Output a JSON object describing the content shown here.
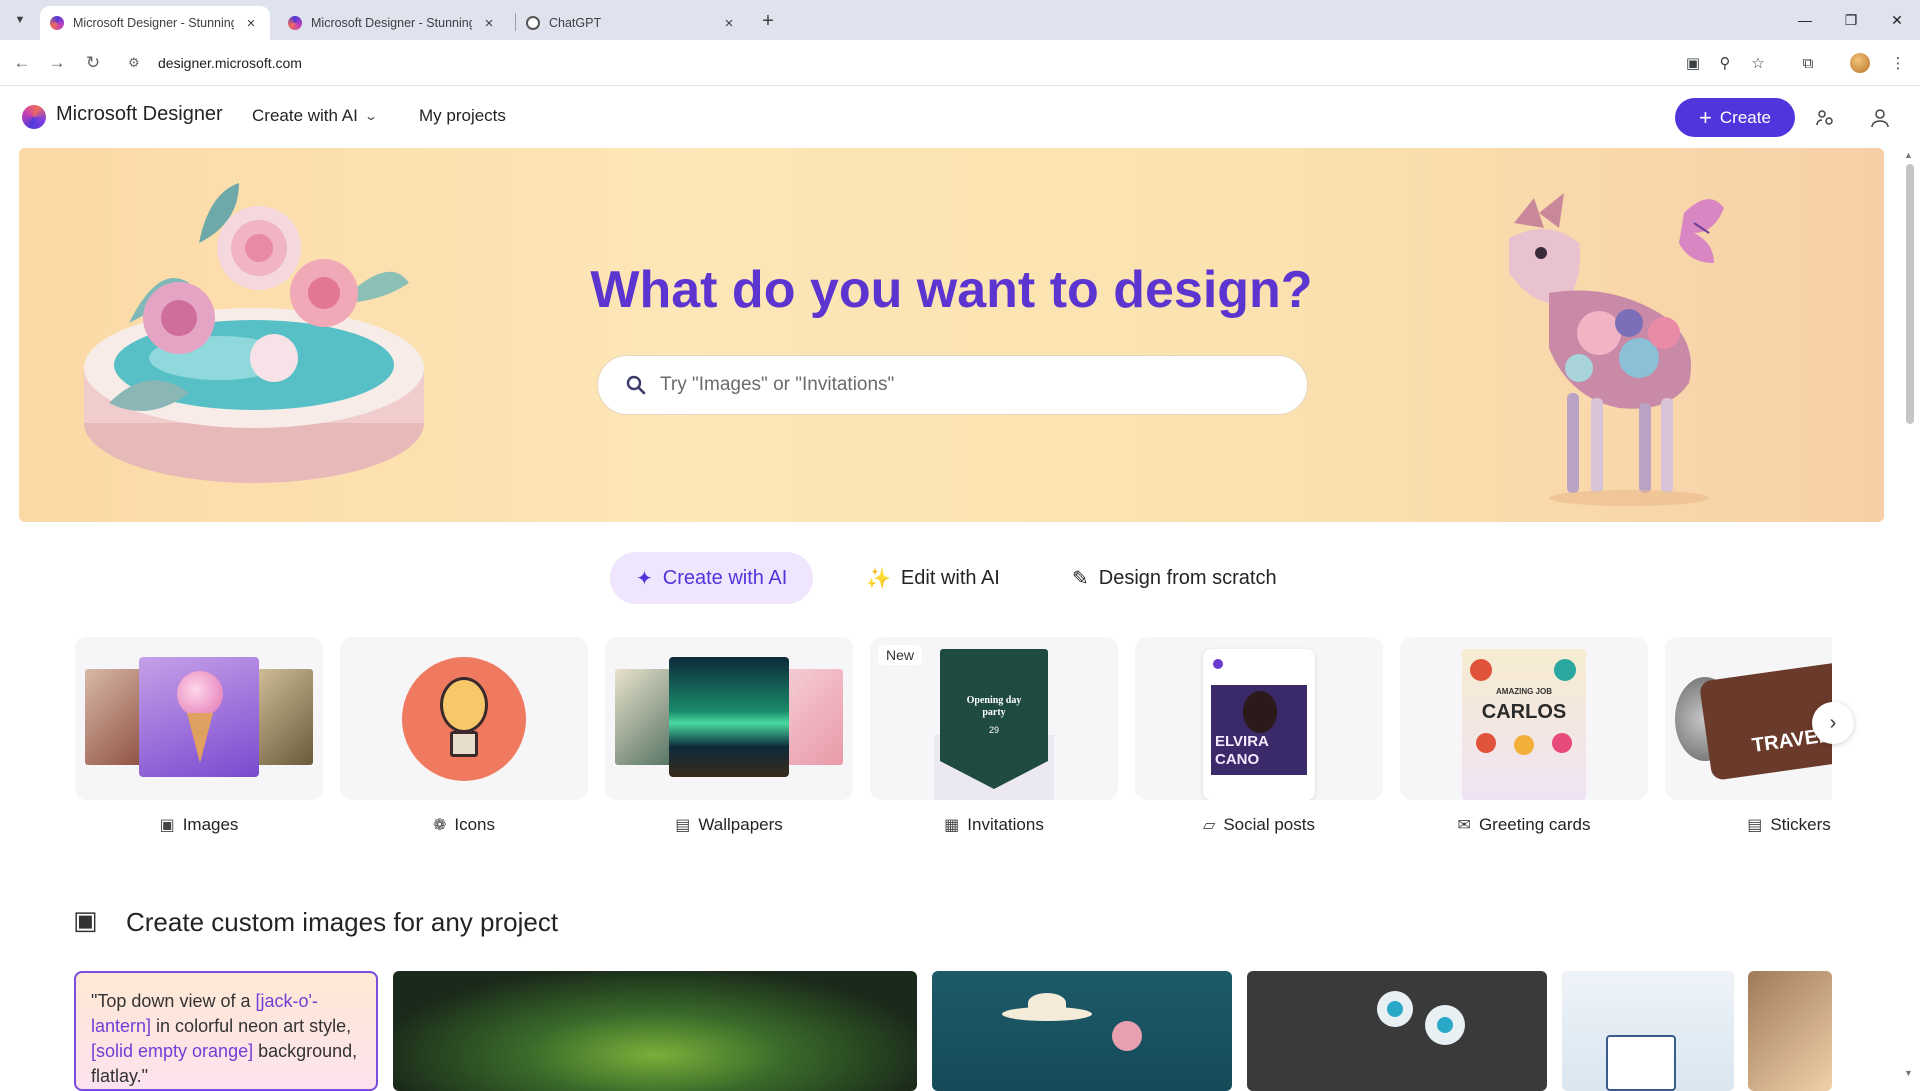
{
  "browser": {
    "tabs": [
      {
        "title": "Microsoft Designer - Stunning",
        "active": true
      },
      {
        "title": "Microsoft Designer - Stunning",
        "active": false
      },
      {
        "title": "ChatGPT",
        "active": false
      }
    ],
    "url": "designer.microsoft.com"
  },
  "header": {
    "brand": "Microsoft Designer",
    "nav_create": "Create with AI",
    "nav_projects": "My projects",
    "create_button": "Create"
  },
  "hero": {
    "title": "What do you want to design?",
    "search_placeholder": "Try \"Images\" or \"Invitations\""
  },
  "mode_tabs": [
    {
      "label": "Create with AI",
      "active": true
    },
    {
      "label": "Edit with AI",
      "active": false
    },
    {
      "label": "Design from scratch",
      "active": false
    }
  ],
  "categories": [
    {
      "label": "Images",
      "icon": "image-sparkle-icon"
    },
    {
      "label": "Icons",
      "icon": "icon-sparkle-icon"
    },
    {
      "label": "Wallpapers",
      "icon": "wallpaper-icon"
    },
    {
      "label": "Invitations",
      "icon": "calendar-icon",
      "badge": "New",
      "thumb_text_1": "Opening day",
      "thumb_text_2": "party",
      "thumb_text_3": "29"
    },
    {
      "label": "Social posts",
      "icon": "social-post-icon",
      "thumb_text_1": "ELVIRA",
      "thumb_text_2": "CANO"
    },
    {
      "label": "Greeting cards",
      "icon": "envelope-icon",
      "thumb_text_1": "AMAZING JOB",
      "thumb_text_2": "CARLOS"
    },
    {
      "label": "Stickers",
      "icon": "sticker-icon",
      "thumb_text_1": "TRAVEL"
    }
  ],
  "section": {
    "title": "Create custom images for any project",
    "prompt_parts": [
      "\"Top down view of a ",
      "[jack-o'-lantern]",
      " in colorful neon art style, ",
      "[solid empty orange]",
      " background, flatlay.\""
    ]
  },
  "colors": {
    "accent": "#5034dc",
    "hero_title": "#5c34cf",
    "active_tab_bg": "#efe5fc"
  }
}
